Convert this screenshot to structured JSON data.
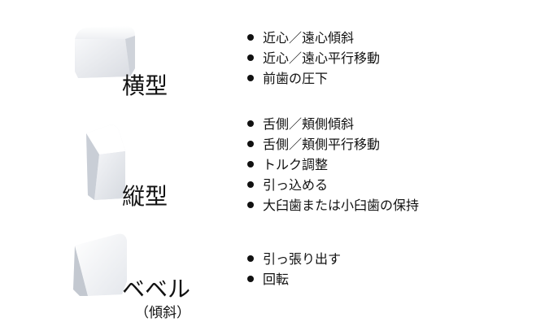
{
  "attachments": [
    {
      "name": "横型",
      "features": [
        "近心／遠心傾斜",
        "近心／遠心平行移動",
        "前歯の圧下"
      ]
    },
    {
      "name": "縦型",
      "features": [
        "舌側／頬側傾斜",
        "舌側／頬側平行移動",
        "トルク調整",
        "引っ込める",
        "大臼歯または小臼歯の保持"
      ]
    },
    {
      "name": "ベベル",
      "subtitle": "（傾斜）",
      "features": [
        "引っ張り出す",
        "回転"
      ]
    }
  ],
  "colors": {
    "shape_light": "#ffffff",
    "shape_mid": "#e6e8ed",
    "shape_dark": "#b9bec7",
    "text": "#111111"
  }
}
